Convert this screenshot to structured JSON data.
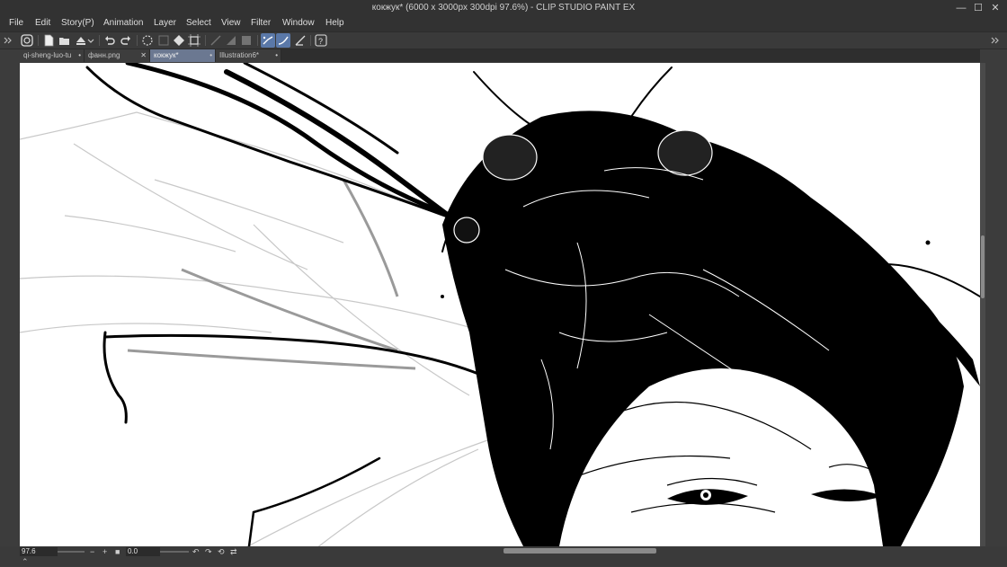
{
  "window": {
    "title": "кокжук* (6000 x 3000px 300dpi 97.6%)  - CLIP STUDIO PAINT EX",
    "minimize_glyph": "—",
    "maximize_glyph": "☐",
    "close_glyph": "✕"
  },
  "menu": [
    "File",
    "Edit",
    "Story(P)",
    "Animation",
    "Layer",
    "Select",
    "View",
    "Filter",
    "Window",
    "Help"
  ],
  "toolbar": {
    "icons": [
      "clip-studio-icon",
      "new-file-icon",
      "open-file-icon",
      "save-icon",
      "undo-icon",
      "redo-icon",
      "clear-icon",
      "fill-icon",
      "transform-icon",
      "snap-ruler-icon",
      "snap-special-icon",
      "snap-grid-icon",
      "stabilization-icon",
      "help-icon"
    ]
  },
  "tabs": [
    {
      "label": "qi-sheng-luo-tu",
      "active": false,
      "close": "•"
    },
    {
      "label": "фанн.png",
      "active": false,
      "close": "✕"
    },
    {
      "label": "кокжук*",
      "active": true,
      "close": "•"
    },
    {
      "label": "Illustration6*",
      "active": false,
      "close": "•"
    }
  ],
  "status": {
    "zoom": "97.6",
    "zoom_out": "−",
    "zoom_in": "+",
    "rotation": "0.0",
    "scroll_position": 0.5
  },
  "colors": {
    "accent": "#5a78a8",
    "active_tab": "#6b7891",
    "ink": "#000000"
  }
}
